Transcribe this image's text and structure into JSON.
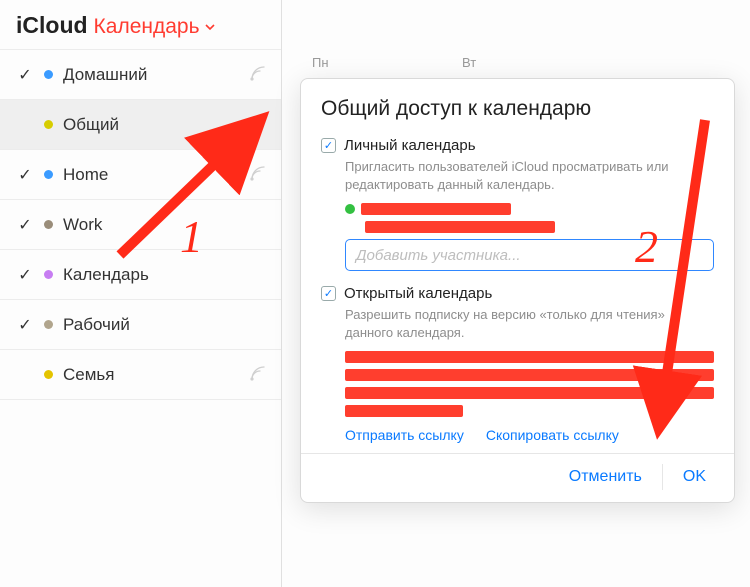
{
  "header": {
    "brand": "iCloud",
    "dropdown": "Календарь"
  },
  "calendars": [
    {
      "label": "Домашний",
      "checked": true,
      "color": "#3b9bff",
      "shared": true
    },
    {
      "label": "Общий",
      "checked": false,
      "color": "#d7cd00",
      "shared": true,
      "selected": true
    },
    {
      "label": "Home",
      "checked": true,
      "color": "#3b9bff",
      "shared": true
    },
    {
      "label": "Work",
      "checked": true,
      "color": "#9a8d7a",
      "shared": false
    },
    {
      "label": "Календарь",
      "checked": true,
      "color": "#c77df2",
      "shared": false
    },
    {
      "label": "Рабочий",
      "checked": true,
      "color": "#b1a58d",
      "shared": false
    },
    {
      "label": "Семья",
      "checked": false,
      "color": "#e4c400",
      "shared": true
    }
  ],
  "weekdays": [
    "Пн",
    "Вт"
  ],
  "popover": {
    "title": "Общий доступ к календарю",
    "private": {
      "label": "Личный календарь",
      "desc": "Пригласить пользователей iCloud просматривать или редактировать данный календарь."
    },
    "add_placeholder": "Добавить участника...",
    "public": {
      "label": "Открытый календарь",
      "desc": "Разрешить подписку на версию «только для чтения» данного календаря."
    },
    "send_link": "Отправить ссылку",
    "copy_link": "Скопировать ссылку",
    "cancel": "Отменить",
    "ok": "OK"
  },
  "annotations": {
    "one": "1",
    "two": "2"
  }
}
